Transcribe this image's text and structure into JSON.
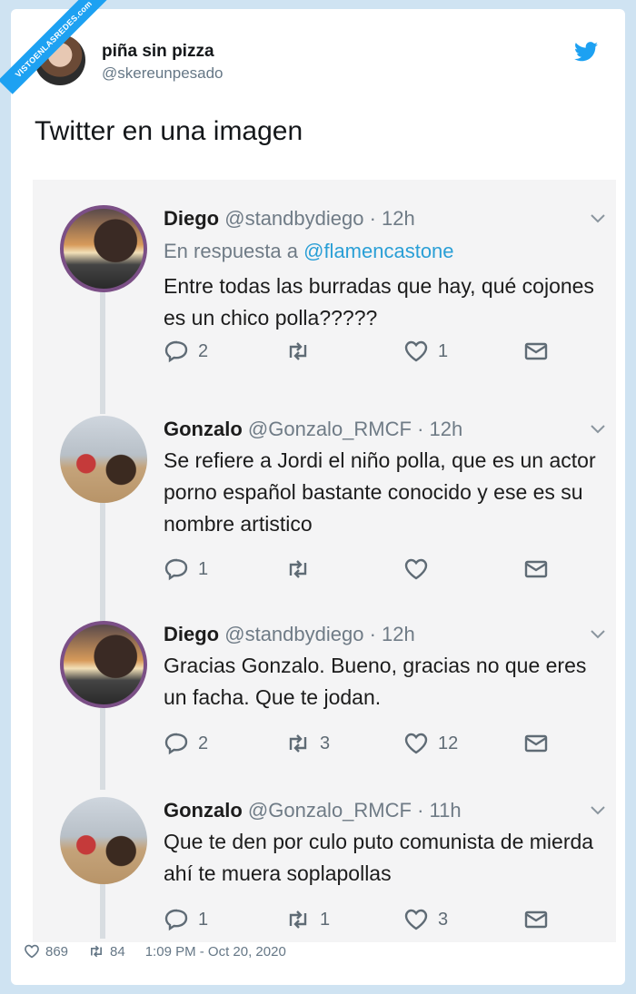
{
  "watermark": "VISTOENLASREDES.com",
  "author": {
    "name": "piña sin pizza",
    "handle": "@skereunpesado"
  },
  "tweet": {
    "text": "Twitter en una imagen"
  },
  "replies": [
    {
      "name": "Diego",
      "handle": "@standbydiego",
      "dot": "·",
      "time": "12h",
      "replying_label": "En respuesta a",
      "replying_to": "@flamencastone",
      "text": "Entre todas las burradas que hay, qué cojones es un chico polla?????",
      "reply_count": "2",
      "retweet_count": "",
      "like_count": "1"
    },
    {
      "name": "Gonzalo",
      "handle": "@Gonzalo_RMCF",
      "dot": "·",
      "time": "12h",
      "text": "Se refiere a Jordi el niño polla, que es un actor porno español bastante conocido y ese es su nombre artistico",
      "reply_count": "1",
      "retweet_count": "",
      "like_count": ""
    },
    {
      "name": "Diego",
      "handle": "@standbydiego",
      "dot": "·",
      "time": "12h",
      "text": "Gracias Gonzalo. Bueno, gracias no que eres un facha. Que te jodan.",
      "reply_count": "2",
      "retweet_count": "3",
      "like_count": "12"
    },
    {
      "name": "Gonzalo",
      "handle": "@Gonzalo_RMCF",
      "dot": "·",
      "time": "11h",
      "text": "Que te den por culo puto comunista de mierda ahí te muera soplapollas",
      "reply_count": "1",
      "retweet_count": "1",
      "like_count": "3"
    }
  ],
  "footer": {
    "likes": "869",
    "retweets": "84",
    "timestamp": "1:09 PM - Oct 20, 2020"
  },
  "colors": {
    "twitter_blue": "#1da1f2",
    "page_bg": "#cfe3f2",
    "mention": "#2a9fd6"
  }
}
